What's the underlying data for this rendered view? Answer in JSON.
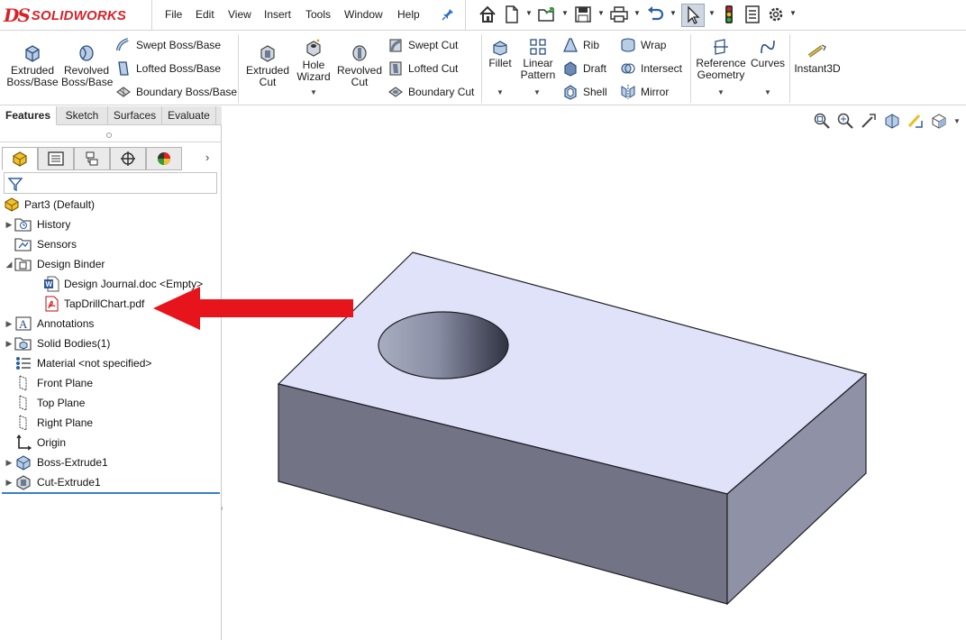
{
  "app": {
    "brand_prefix": "DS",
    "brand_name": "SOLIDWORKS"
  },
  "menu": [
    "File",
    "Edit",
    "View",
    "Insert",
    "Tools",
    "Window",
    "Help"
  ],
  "ribbon": {
    "extruded_boss": "Extruded Boss/Base",
    "revolved_boss": "Revolved Boss/Base",
    "swept_boss": "Swept Boss/Base",
    "lofted_boss": "Lofted Boss/Base",
    "boundary_boss": "Boundary Boss/Base",
    "extruded_cut": "Extruded Cut",
    "hole_wizard": "Hole Wizard",
    "revolved_cut": "Revolved Cut",
    "swept_cut": "Swept Cut",
    "lofted_cut": "Lofted Cut",
    "boundary_cut": "Boundary Cut",
    "fillet": "Fillet",
    "linear_pattern": "Linear Pattern",
    "rib": "Rib",
    "draft": "Draft",
    "shell": "Shell",
    "wrap": "Wrap",
    "intersect": "Intersect",
    "mirror": "Mirror",
    "reference_geometry": "Reference Geometry",
    "curves": "Curves",
    "instant3d": "Instant3D"
  },
  "command_tabs": [
    "Features",
    "Sketch",
    "Surfaces",
    "Evaluate"
  ],
  "active_command_tab": "Features",
  "tree": {
    "root": "Part3  (Default)",
    "items": [
      {
        "label": "History",
        "expandable": true,
        "icon": "history-folder-icon"
      },
      {
        "label": "Sensors",
        "expandable": false,
        "icon": "sensors-folder-icon"
      },
      {
        "label": "Design Binder",
        "expandable": true,
        "expanded": true,
        "icon": "design-binder-icon"
      },
      {
        "label": "Design Journal.doc <Empty>",
        "child": true,
        "icon": "word-doc-icon"
      },
      {
        "label": "TapDrillChart.pdf",
        "child": true,
        "icon": "pdf-file-icon",
        "highlighted": true
      },
      {
        "label": "Annotations",
        "expandable": true,
        "icon": "annotations-icon"
      },
      {
        "label": "Solid Bodies(1)",
        "expandable": true,
        "icon": "solid-bodies-icon"
      },
      {
        "label": "Material <not specified>",
        "expandable": false,
        "icon": "material-icon"
      },
      {
        "label": "Front Plane",
        "expandable": false,
        "icon": "plane-icon"
      },
      {
        "label": "Top Plane",
        "expandable": false,
        "icon": "plane-icon"
      },
      {
        "label": "Right Plane",
        "expandable": false,
        "icon": "plane-icon"
      },
      {
        "label": "Origin",
        "expandable": false,
        "icon": "origin-icon"
      },
      {
        "label": "Boss-Extrude1",
        "expandable": true,
        "icon": "boss-extrude-icon"
      },
      {
        "label": "Cut-Extrude1",
        "expandable": true,
        "icon": "cut-extrude-icon"
      }
    ]
  },
  "colors": {
    "brand": "#d6232a",
    "arrow": "#e8141b",
    "top_face": "#dfe2f8",
    "front_face": "#727486",
    "right_face": "#8f92a6",
    "selection_rule": "#3b7fc4"
  }
}
